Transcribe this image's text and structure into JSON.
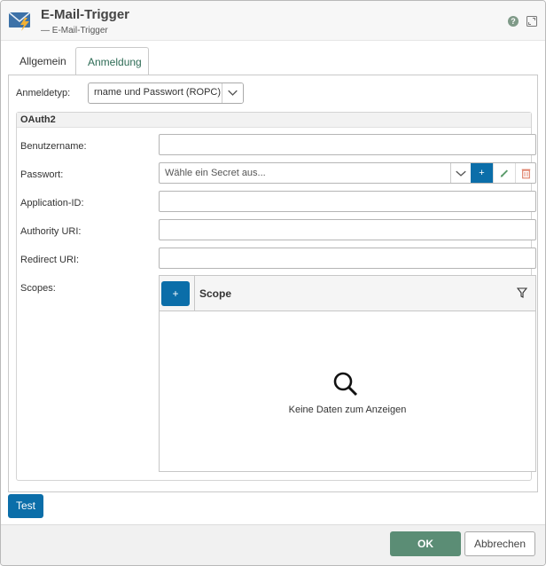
{
  "window": {
    "title": "E-Mail-Trigger",
    "subtitle": "— E-Mail-Trigger",
    "help_glyph": "?"
  },
  "tabs": [
    {
      "label": "Allgemein",
      "active": false
    },
    {
      "label": "Anmeldung",
      "active": true
    }
  ],
  "anmeldetyp": {
    "label": "Anmeldetyp:",
    "value": "rname und Passwort (ROPC)"
  },
  "oauth2": {
    "section_title": "OAuth2",
    "benutzername": {
      "label": "Benutzername:",
      "value": ""
    },
    "passwort": {
      "label": "Passwort:",
      "placeholder": "Wähle ein Secret aus...",
      "add_glyph": "+"
    },
    "application_id": {
      "label": "Application-ID:",
      "value": ""
    },
    "authority_uri": {
      "label": "Authority URI:",
      "value": ""
    },
    "redirect_uri": {
      "label": "Redirect URI:",
      "value": ""
    },
    "scopes": {
      "label": "Scopes:",
      "add_glyph": "+",
      "column": "Scope",
      "empty_text": "Keine Daten zum Anzeigen"
    }
  },
  "buttons": {
    "test": "Test",
    "ok": "OK",
    "cancel": "Abbrechen"
  },
  "colors": {
    "primary_blue": "#0b6ea9",
    "ok_green": "#5b8d75",
    "tab_active_text": "#2d6b55",
    "delete_red": "#e0826b"
  },
  "icons": [
    "mail-trigger-icon",
    "help-icon",
    "maximize-icon",
    "chevron-down-icon",
    "plus-icon",
    "pencil-icon",
    "trash-icon",
    "filter-icon",
    "search-icon"
  ]
}
